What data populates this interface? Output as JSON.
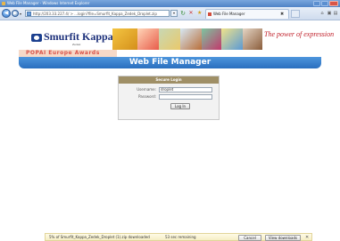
{
  "window": {
    "title": "Web File Manager - Windows Internet Explorer",
    "controls": {
      "minimize": "",
      "maximize": "",
      "close": ""
    }
  },
  "toolbar": {
    "address_url": "http://203.33.227.4/ > ...login?file=Smurfit_Kappa_Zedek_Droplet.zip",
    "go": "▾",
    "tab_label": "Web File Manager",
    "tab_close": "✖"
  },
  "banner": {
    "logo_text": "Smurfit Kappa",
    "logo_sub": "Zedek",
    "tagline": "The power of expression",
    "award_text": "POPAI Europe Awards",
    "title": "Web File Manager"
  },
  "login": {
    "header": "Secure Login",
    "username_label": "Username:",
    "username_value": "droplet",
    "password_label": "Password:",
    "password_value": "",
    "button": "Log In"
  },
  "download": {
    "text": "5% of Smurfit_Kappa_Zedek_Droplet (1).zip downloaded",
    "remaining": "53 sec remaining",
    "cancel": "Cancel",
    "view": "View downloads",
    "close": "✕"
  },
  "colors": {
    "title_strip": "#2a6fbf",
    "login_header": "#9f8f66",
    "tagline": "#c0202a",
    "logo": "#1b2f7a"
  }
}
